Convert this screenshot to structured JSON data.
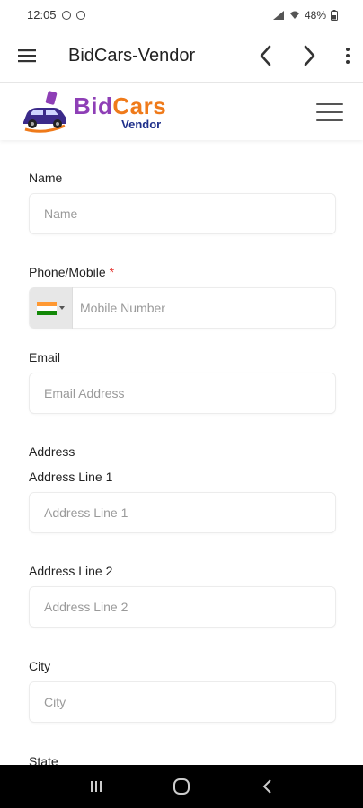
{
  "status_bar": {
    "time": "12:05",
    "battery": "48%"
  },
  "app_bar": {
    "title": "BidCars-Vendor"
  },
  "logo": {
    "brand_part1": "Bid",
    "brand_part2": "Cars",
    "subtitle": "Vendor"
  },
  "form": {
    "name": {
      "label": "Name",
      "placeholder": "Name"
    },
    "phone": {
      "label": "Phone/Mobile",
      "required_mark": "*",
      "placeholder": "Mobile Number",
      "country": "India"
    },
    "email": {
      "label": "Email",
      "placeholder": "Email Address"
    },
    "address_section": "Address",
    "address1": {
      "label": "Address Line 1",
      "placeholder": "Address Line 1"
    },
    "address2": {
      "label": "Address Line 2",
      "placeholder": "Address Line 2"
    },
    "city": {
      "label": "City",
      "placeholder": "City"
    },
    "state": {
      "label": "State"
    }
  },
  "colors": {
    "brand_purple": "#8e3fb6",
    "brand_orange": "#ef7a1a",
    "brand_navy": "#1e2f8a",
    "required_red": "#e53935"
  }
}
